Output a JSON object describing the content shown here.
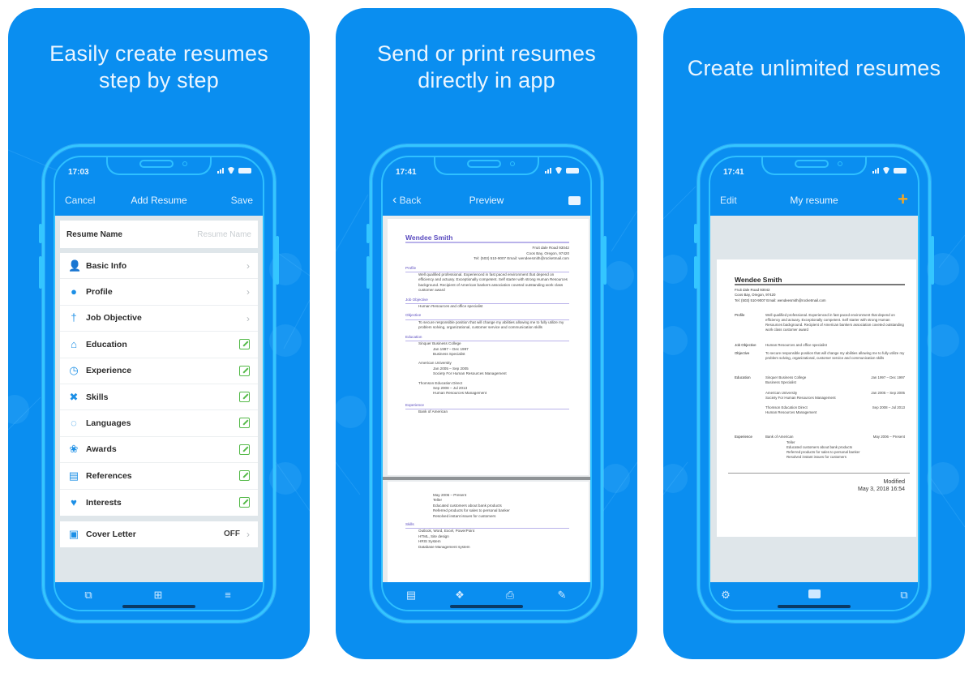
{
  "panels": [
    {
      "headline_line1": "Easily create resumes",
      "headline_line2": "step by step",
      "status_time": "17:03",
      "nav": {
        "left": "Cancel",
        "title": "Add Resume",
        "right": "Save"
      },
      "resume_name": {
        "label": "Resume Name",
        "placeholder": "Resume Name"
      },
      "sections": [
        {
          "label": "Basic Info",
          "icon": "person-icon",
          "accessory": "chevron"
        },
        {
          "label": "Profile",
          "icon": "speech-bubble-icon",
          "accessory": "chevron"
        },
        {
          "label": "Job Objective",
          "icon": "tie-icon",
          "accessory": "chevron"
        },
        {
          "label": "Education",
          "icon": "graduation-cap-icon",
          "accessory": "edit"
        },
        {
          "label": "Experience",
          "icon": "clock-icon",
          "accessory": "edit"
        },
        {
          "label": "Skills",
          "icon": "tools-icon",
          "accessory": "edit"
        },
        {
          "label": "Languages",
          "icon": "chat-icon",
          "accessory": "edit"
        },
        {
          "label": "Awards",
          "icon": "award-ribbon-icon",
          "accessory": "edit"
        },
        {
          "label": "References",
          "icon": "documents-icon",
          "accessory": "edit"
        },
        {
          "label": "Interests",
          "icon": "heart-icon",
          "accessory": "edit"
        }
      ],
      "cover_letter": {
        "label": "Cover Letter",
        "value": "OFF",
        "icon": "briefcase-icon"
      },
      "tabbar_icons": [
        "copy-icon",
        "add-document-icon",
        "reorder-icon"
      ]
    },
    {
      "headline_line1": "Send or print resumes",
      "headline_line2": "directly in app",
      "status_time": "17:41",
      "nav": {
        "left": "Back",
        "title": "Preview",
        "right_icon": "mail-icon"
      },
      "tabbar_icons": [
        "save-document-icon",
        "dropbox-icon",
        "print-icon",
        "edit-icon"
      ]
    },
    {
      "headline_line1": "Create unlimited resumes",
      "status_time": "17:41",
      "nav": {
        "left": "Edit",
        "title": "My resume",
        "right_icon": "plus-icon"
      },
      "tabbar_icons": [
        "settings-icon",
        "mail-icon",
        "copy-icon"
      ],
      "modified_label": "Modified",
      "modified_date": "May 3, 2018 16:54"
    }
  ],
  "resume": {
    "name": "Wendee  Smith",
    "address1": "Fruit dale Road 93042",
    "address2": "Coos Bay, Oregon, 97420",
    "contact": "Tel: (503) 510-9007 Email: wendeesmith@rocketmail.com",
    "sections": {
      "profile": "Profile",
      "job_objective": "Job Objective",
      "objective": "Objective",
      "education": "Education",
      "experience": "Experience",
      "skills": "Skills"
    },
    "profile_text": "Well qualified professional. Experienced in fast paced environment that depend on efficiency and actuary. Exceptionally competent. Self starter with strong Human Resources background. Recipient of American bankers association coveted outstanding work class customer award",
    "job_objective_text": "Human Resources and office specialist",
    "objective_text": "To secure responsible position that will change my abilities allowing me to fully utilize my problem solving, organizational, customer service and communication skills",
    "education": [
      {
        "school": "Sinquer Business College",
        "dates": "Jan 1997 – Dec 1997",
        "detail": "Business Specialist"
      },
      {
        "school": "American University",
        "dates": "Jan 2005 – Sep 2005",
        "detail": "Society For Human Resources Management"
      },
      {
        "school": "Thomson Education Direct",
        "dates": "Sep 2008 – Jul 2013",
        "detail": "Human Resources Management"
      }
    ],
    "experience": {
      "company": "Bank of American",
      "dates": "May 2006 – Present",
      "title": "Teller",
      "duties": [
        "Educated customers about bank products",
        "Referred products for sales to personal banker",
        "Resolved instant issues for customers"
      ]
    },
    "skills": [
      "Outlook, Word, Excel, PowerPoint",
      "HTML, Site design",
      "HRIS System",
      "Database Management system"
    ]
  },
  "colors": {
    "panel_bg": "#0a8ef0",
    "frame": "#34c6ff",
    "accent_purple": "#5a4bbf",
    "edit_green": "#54b948",
    "plus_orange": "#f5a623"
  }
}
